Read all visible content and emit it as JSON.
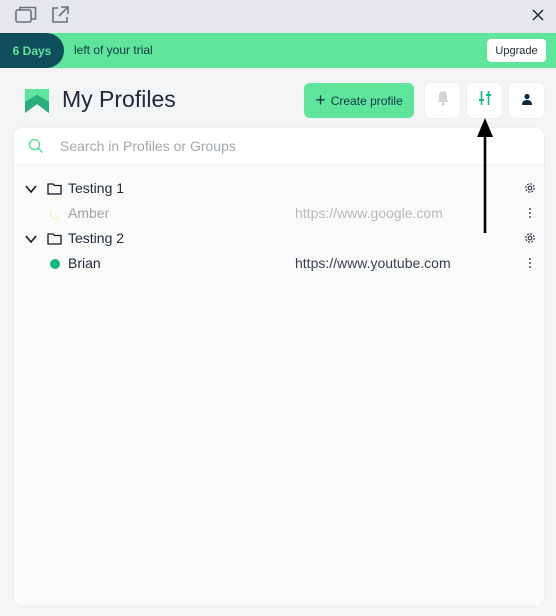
{
  "titlebar": {
    "icons": [
      "window-icon",
      "external-link-icon"
    ],
    "close_icon": "close-icon"
  },
  "trial": {
    "days": "6 Days",
    "text": "left of your trial",
    "upgrade_label": "Upgrade"
  },
  "header": {
    "title": "My Profiles",
    "create_label": "Create profile",
    "buttons": [
      "bell-icon",
      "sliders-icon",
      "user-icon"
    ]
  },
  "search": {
    "placeholder": "Search in Profiles or Groups"
  },
  "groups": [
    {
      "name": "Testing 1",
      "profiles": [
        {
          "name": "Amber",
          "url": "https://www.google.com",
          "state": "loading"
        }
      ]
    },
    {
      "name": "Testing 2",
      "profiles": [
        {
          "name": "Brian",
          "url": "https://www.youtube.com",
          "state": "active"
        }
      ]
    }
  ],
  "colors": {
    "brand_green": "#5ee49b",
    "brand_dark": "#0f4c5c",
    "status_active": "#10b981",
    "text_muted": "#9ca3af"
  }
}
